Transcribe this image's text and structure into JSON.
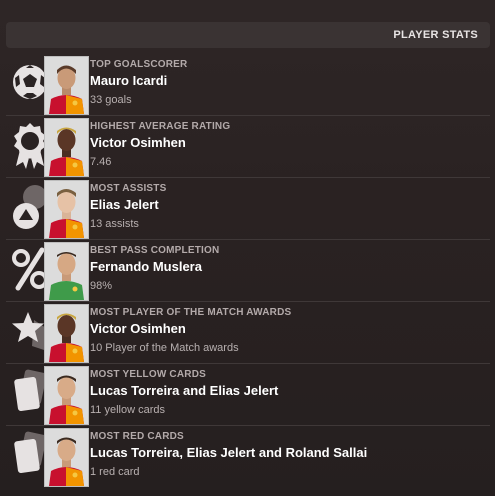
{
  "header": {
    "title": "PLAYER STATS"
  },
  "stats": [
    {
      "category": "TOP GOALSCORER",
      "player": "Mauro Icardi",
      "value": "33 goals",
      "icon": "football-icon",
      "kit": "home"
    },
    {
      "category": "HIGHEST AVERAGE RATING",
      "player": "Victor Osimhen",
      "value": "7.46",
      "icon": "rosette-icon",
      "kit": "home"
    },
    {
      "category": "MOST ASSISTS",
      "player": "Elias Jelert",
      "value": "13 assists",
      "icon": "assist-icon",
      "kit": "home"
    },
    {
      "category": "BEST PASS COMPLETION",
      "player": "Fernando Muslera",
      "value": "98%",
      "icon": "percent-icon",
      "kit": "goalkeeper"
    },
    {
      "category": "MOST PLAYER OF THE MATCH AWARDS",
      "player": "Victor Osimhen",
      "value": "10 Player of the Match awards",
      "icon": "star-icon",
      "kit": "home"
    },
    {
      "category": "MOST YELLOW CARDS",
      "player": "Lucas Torreira and Elias Jelert",
      "value": "11 yellow cards",
      "icon": "card-icon",
      "kit": "home"
    },
    {
      "category": "MOST RED CARDS",
      "player": "Lucas Torreira, Elias Jelert and Roland Sallai",
      "value": "1 red card",
      "icon": "card-icon",
      "kit": "home"
    }
  ],
  "colors": {
    "kit_red": "#c8102e",
    "kit_orange": "#f29400",
    "keeper_green": "#3f9b4a"
  }
}
